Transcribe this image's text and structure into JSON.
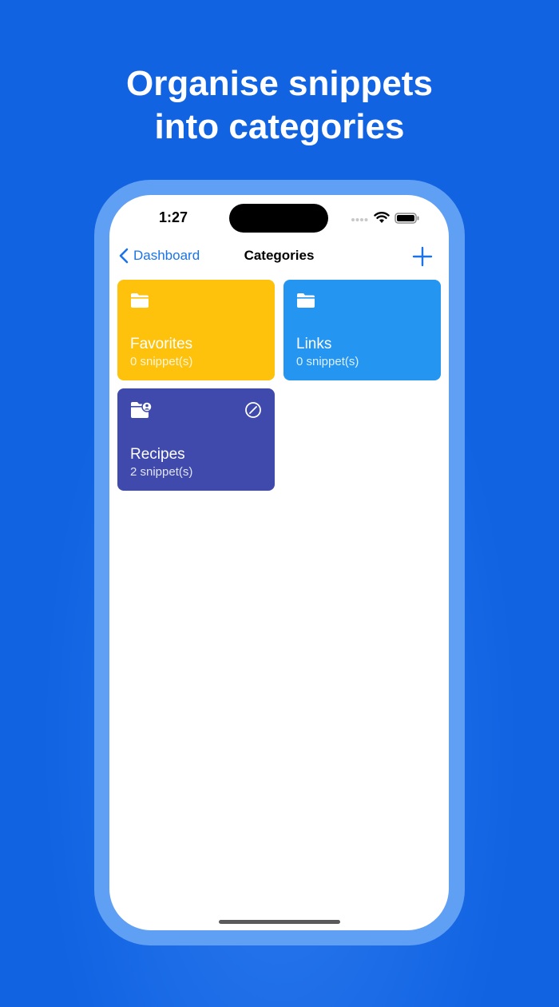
{
  "headline": {
    "line1": "Organise snippets",
    "line2": "into categories"
  },
  "status_bar": {
    "time": "1:27"
  },
  "nav": {
    "back_label": "Dashboard",
    "title": "Categories"
  },
  "categories": [
    {
      "name": "Favorites",
      "count": "0 snippet(s)",
      "color": "#fec10c",
      "icon": "folder-icon"
    },
    {
      "name": "Links",
      "count": "0 snippet(s)",
      "color": "#2496f2",
      "icon": "folder-icon"
    },
    {
      "name": "Recipes",
      "count": "2 snippet(s)",
      "color": "#3f4aac",
      "icon": "shared-folder-icon",
      "badge_icon": "slash-circle-icon"
    }
  ],
  "colors": {
    "background": "#1163e2",
    "accent": "#1a73e8"
  }
}
